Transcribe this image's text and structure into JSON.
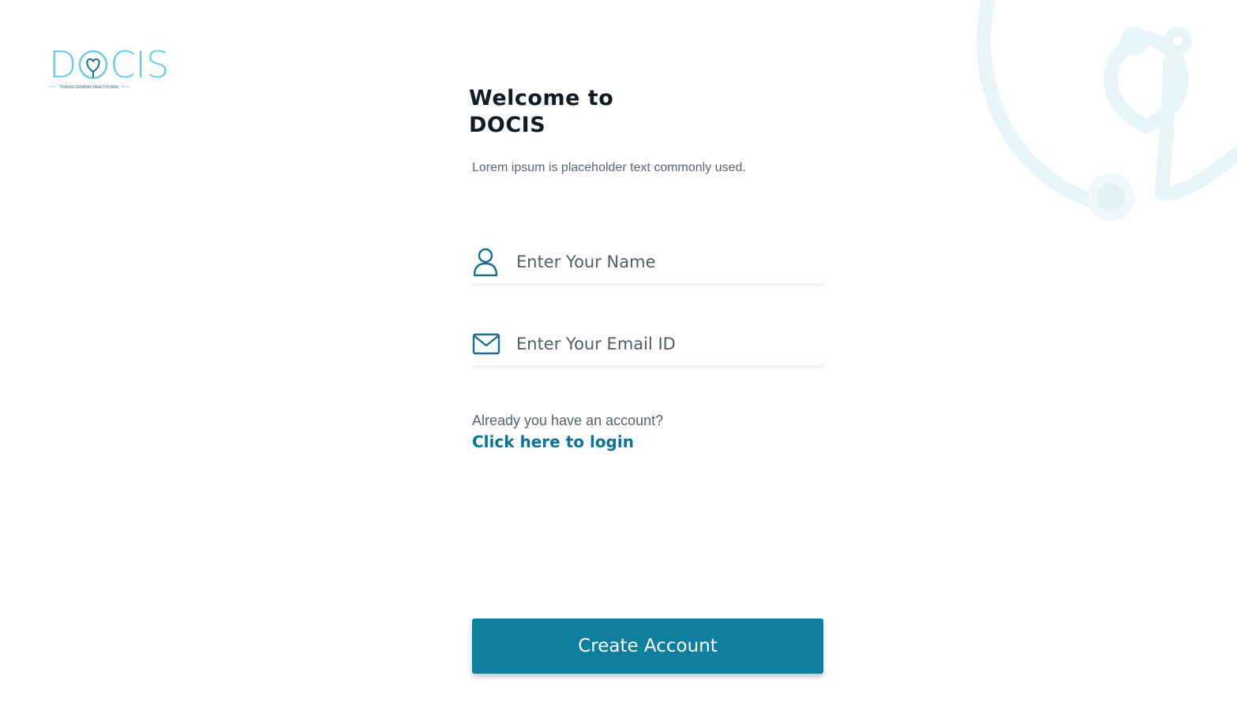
{
  "logo": {
    "letters_before": "D",
    "letters_after": "CIS",
    "tagline": "TRANSFORMING HEALTHCARE",
    "tagline_dots_left": "•••",
    "tagline_dots_right": "•••",
    "color": "#6ec9df"
  },
  "header": {
    "title_line1": "Welcome to",
    "title_line2": "DOCIS",
    "subtitle": "Lorem ipsum is placeholder text commonly used."
  },
  "form": {
    "name_placeholder": "Enter Your Name",
    "name_value": "",
    "email_placeholder": "Enter Your Email ID",
    "email_value": "",
    "name_icon": "user-icon",
    "email_icon": "mail-icon"
  },
  "login": {
    "question": "Already you have an account?",
    "link_label": "Click here to login"
  },
  "actions": {
    "create_account_label": "Create Account"
  },
  "colors": {
    "accent": "#0f7fa0",
    "link": "#0e7392",
    "title": "#141b22",
    "watermark": "#e6f5f9"
  }
}
